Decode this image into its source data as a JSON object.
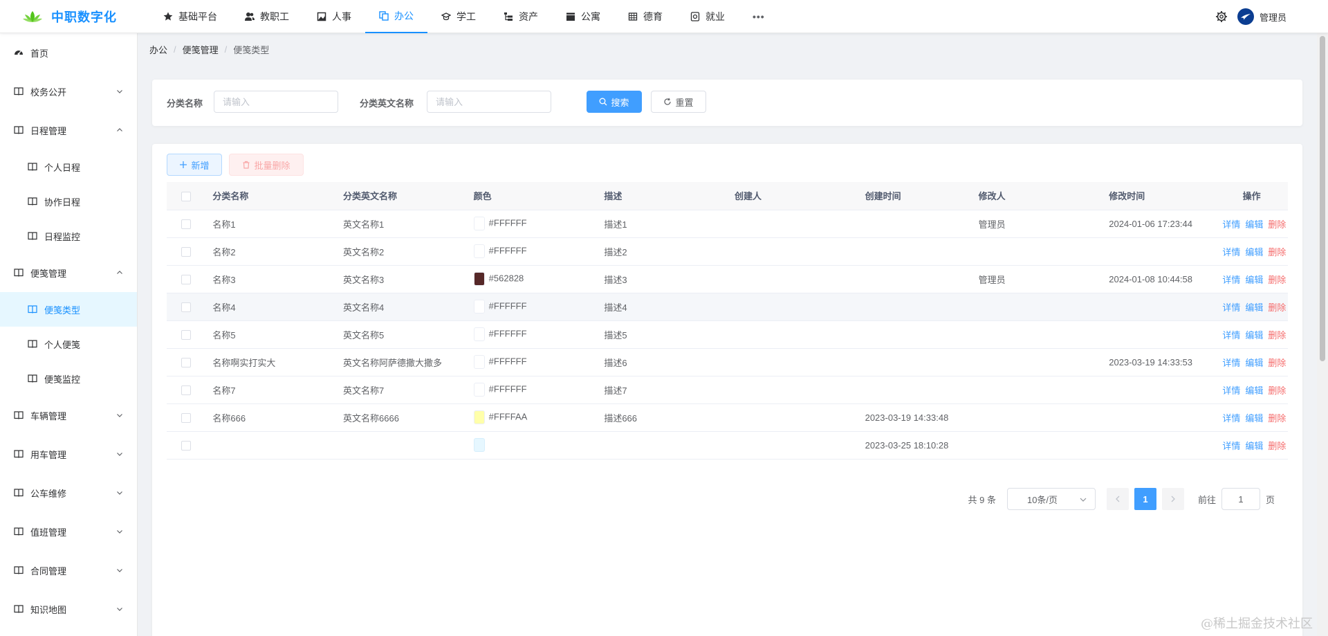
{
  "app": {
    "title": "中职数字化",
    "brand_color": "#1890ff"
  },
  "topnav": {
    "items": [
      {
        "label": "基础平台",
        "icon": "star-icon"
      },
      {
        "label": "教职工",
        "icon": "users-icon"
      },
      {
        "label": "人事",
        "icon": "image-icon"
      },
      {
        "label": "办公",
        "icon": "copy-icon",
        "active": true
      },
      {
        "label": "学工",
        "icon": "student-icon"
      },
      {
        "label": "资产",
        "icon": "tree-list-icon"
      },
      {
        "label": "公寓",
        "icon": "clapper-icon"
      },
      {
        "label": "德育",
        "icon": "grid-icon"
      },
      {
        "label": "就业",
        "icon": "target-icon"
      }
    ],
    "more_label": "•••",
    "user": "管理员"
  },
  "sidebar": {
    "items": [
      {
        "label": "首页",
        "icon": "dashboard-icon"
      },
      {
        "label": "校务公开",
        "icon": "book-icon",
        "expanded": false
      },
      {
        "label": "日程管理",
        "icon": "book-icon",
        "expanded": true,
        "children": [
          {
            "label": "个人日程"
          },
          {
            "label": "协作日程"
          },
          {
            "label": "日程监控"
          }
        ]
      },
      {
        "label": "便笺管理",
        "icon": "book-icon",
        "expanded": true,
        "children": [
          {
            "label": "便笺类型",
            "active": true
          },
          {
            "label": "个人便笺"
          },
          {
            "label": "便笺监控"
          }
        ]
      },
      {
        "label": "车辆管理",
        "icon": "book-icon",
        "expanded": false
      },
      {
        "label": "用车管理",
        "icon": "book-icon",
        "expanded": false
      },
      {
        "label": "公车维修",
        "icon": "book-icon",
        "expanded": false
      },
      {
        "label": "值班管理",
        "icon": "book-icon",
        "expanded": false
      },
      {
        "label": "合同管理",
        "icon": "book-icon",
        "expanded": false
      },
      {
        "label": "知识地图",
        "icon": "book-icon",
        "expanded": false
      }
    ]
  },
  "breadcrumb": [
    "办公",
    "便笺管理",
    "便笺类型"
  ],
  "search": {
    "name_label": "分类名称",
    "name_placeholder": "请输入",
    "en_label": "分类英文名称",
    "en_placeholder": "请输入",
    "search_label": "搜索",
    "reset_label": "重置"
  },
  "toolbar": {
    "add_label": "新增",
    "batch_delete_label": "批量删除"
  },
  "table": {
    "columns": [
      "分类名称",
      "分类英文名称",
      "颜色",
      "描述",
      "创建人",
      "创建时间",
      "修改人",
      "修改时间",
      "操作"
    ],
    "actions": {
      "detail": "详情",
      "edit": "编辑",
      "delete": "删除"
    },
    "rows": [
      {
        "name": "名称1",
        "en": "英文名称1",
        "color": "#FFFFFF",
        "desc": "描述1",
        "creator": "",
        "created": "",
        "modifier": "管理员",
        "modified": "2024-01-06 17:23:44"
      },
      {
        "name": "名称2",
        "en": "英文名称2",
        "color": "#FFFFFF",
        "desc": "描述2",
        "creator": "",
        "created": "",
        "modifier": "",
        "modified": ""
      },
      {
        "name": "名称3",
        "en": "英文名称3",
        "color": "#562828",
        "desc": "描述3",
        "creator": "",
        "created": "",
        "modifier": "管理员",
        "modified": "2024-01-08 10:44:58"
      },
      {
        "name": "名称4",
        "en": "英文名称4",
        "color": "#FFFFFF",
        "desc": "描述4",
        "creator": "",
        "created": "",
        "modifier": "",
        "modified": ""
      },
      {
        "name": "名称5",
        "en": "英文名称5",
        "color": "#FFFFFF",
        "desc": "描述5",
        "creator": "",
        "created": "",
        "modifier": "",
        "modified": ""
      },
      {
        "name": "名称啊实打实大",
        "en": "英文名称阿萨德撒大撒多",
        "color": "#FFFFFF",
        "desc": "描述6",
        "creator": "",
        "created": "",
        "modifier": "",
        "modified": "2023-03-19 14:33:53"
      },
      {
        "name": "名称7",
        "en": "英文名称7",
        "color": "#FFFFFF",
        "desc": "描述7",
        "creator": "",
        "created": "",
        "modifier": "",
        "modified": ""
      },
      {
        "name": "名称666",
        "en": "英文名称6666",
        "color": "#FFFFAA",
        "desc": "描述666",
        "creator": "",
        "created": "2023-03-19 14:33:48",
        "modifier": "",
        "modified": ""
      },
      {
        "name": "",
        "en": "",
        "color": "",
        "swatch": "#E6F7FF",
        "desc": "",
        "creator": "",
        "created": "2023-03-25 18:10:28",
        "modifier": "",
        "modified": ""
      }
    ]
  },
  "pagination": {
    "total_label": "共 9 条",
    "page_size_label": "10条/页",
    "current_page": "1",
    "goto_label": "前往",
    "goto_value": "1",
    "page_suffix": "页"
  },
  "watermark": "@稀土掘金技术社区"
}
